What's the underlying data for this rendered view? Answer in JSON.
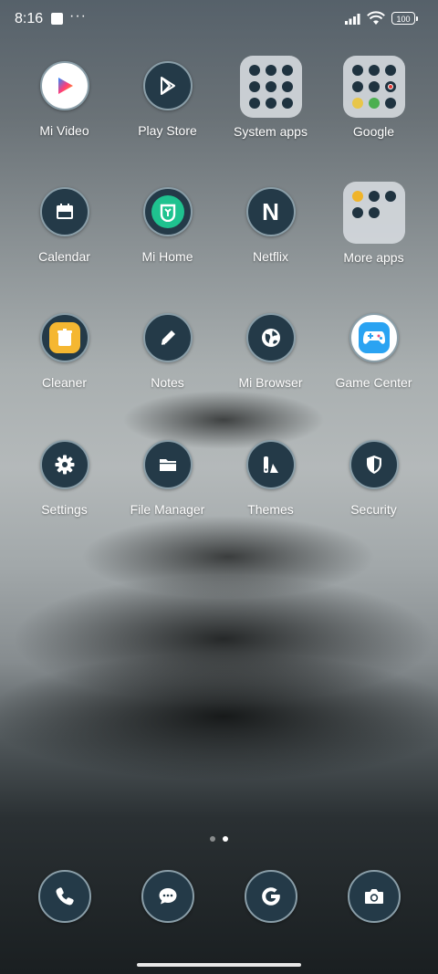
{
  "status": {
    "time": "8:16",
    "battery": "100"
  },
  "apps": [
    {
      "label": "Mi Video"
    },
    {
      "label": "Play Store"
    },
    {
      "label": "System apps"
    },
    {
      "label": "Google"
    },
    {
      "label": "Calendar"
    },
    {
      "label": "Mi Home"
    },
    {
      "label": "Netflix",
      "glyph": "N"
    },
    {
      "label": "More apps"
    },
    {
      "label": "Cleaner"
    },
    {
      "label": "Notes"
    },
    {
      "label": "Mi Browser"
    },
    {
      "label": "Game Center"
    },
    {
      "label": "Settings"
    },
    {
      "label": "File Manager"
    },
    {
      "label": "Themes"
    },
    {
      "label": "Security"
    }
  ],
  "dock": [
    {
      "icon": "phone-icon"
    },
    {
      "icon": "messages-icon"
    },
    {
      "icon": "google-icon"
    },
    {
      "icon": "camera-icon"
    }
  ],
  "pages": {
    "count": 2,
    "active": 2
  },
  "colors": {
    "icon_bg": "#243a48",
    "icon_ring": "#8a9ea8",
    "folder_bg": "#d7dce0",
    "mi_home_green": "#1fc28f"
  }
}
